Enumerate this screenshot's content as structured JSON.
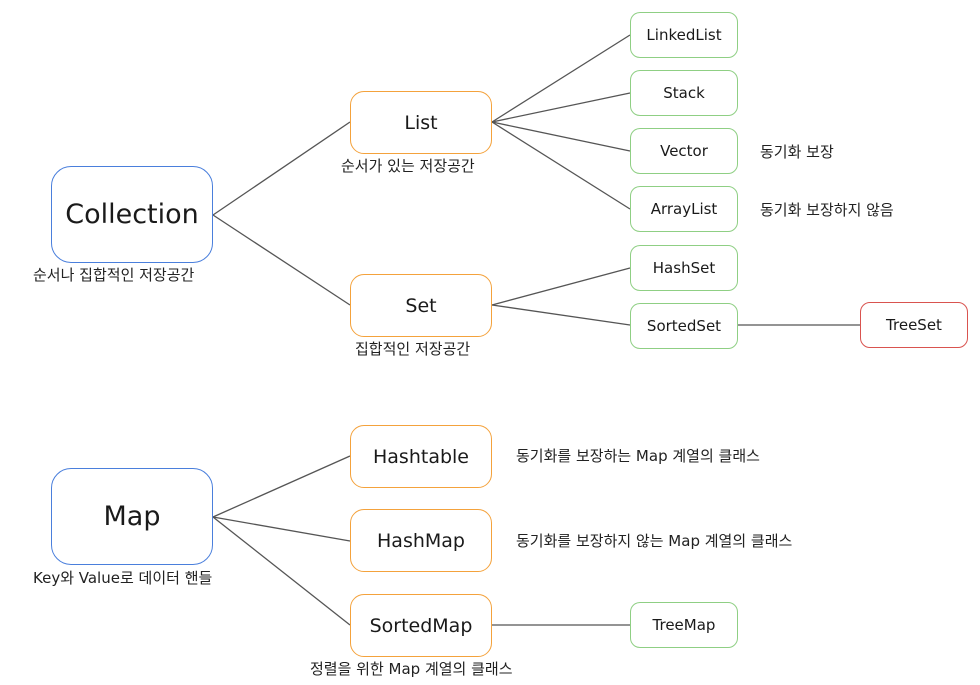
{
  "colors": {
    "root": "#4a7fdc",
    "interface": "#f4a23c",
    "impl": "#8fcf84",
    "leaf": "#d9534f",
    "edge": "#555555"
  },
  "collection": {
    "title": "Collection",
    "caption": "순서나 집합적인 저장공간",
    "list": {
      "title": "List",
      "caption": "순서가 있는 저장공간",
      "children": [
        {
          "title": "LinkedList",
          "note": ""
        },
        {
          "title": "Stack",
          "note": ""
        },
        {
          "title": "Vector",
          "note": "동기화 보장"
        },
        {
          "title": "ArrayList",
          "note": "동기화 보장하지 않음"
        }
      ]
    },
    "set": {
      "title": "Set",
      "caption": "집합적인 저장공간",
      "children": [
        {
          "title": "HashSet"
        },
        {
          "title": "SortedSet",
          "child": "TreeSet"
        }
      ]
    }
  },
  "map": {
    "title": "Map",
    "caption": "Key와 Value로 데이터 핸들",
    "children": [
      {
        "title": "Hashtable",
        "note": "동기화를 보장하는 Map 계열의 클래스"
      },
      {
        "title": "HashMap",
        "note": "동기화를 보장하지 않는 Map 계열의 클래스"
      },
      {
        "title": "SortedMap",
        "caption": "정렬을 위한 Map 계열의 클래스",
        "child": "TreeMap"
      }
    ]
  }
}
